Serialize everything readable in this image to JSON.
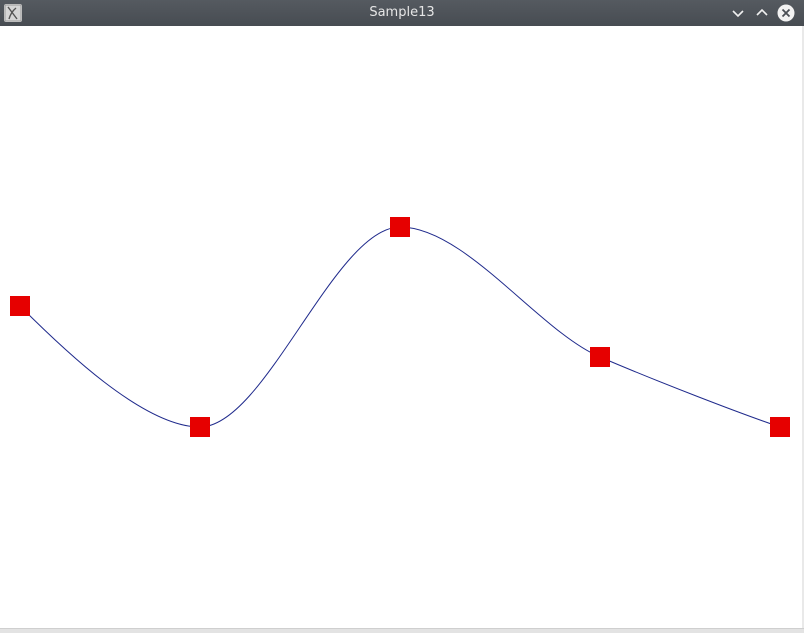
{
  "window": {
    "title": "Sample13",
    "icons": {
      "app": "app-logo-icon",
      "minimize": "chevron-down-icon",
      "maximize": "chevron-up-icon",
      "close": "close-icon"
    },
    "colors": {
      "titlebar": "#4d5257",
      "title_text": "#e6e6e6",
      "canvas_background": "#ffffff",
      "curve": "#1f2a8c",
      "control_point": "#e60000"
    }
  },
  "curve": {
    "type": "cubic-spline-through-control-points",
    "control_point_count": 5
  }
}
